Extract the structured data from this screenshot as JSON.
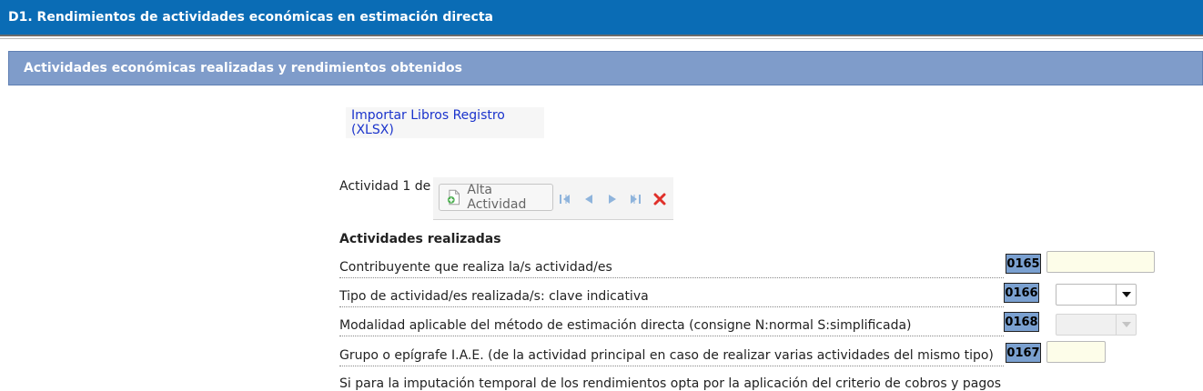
{
  "header": {
    "title": "D1.  Rendimientos de actividades económicas en estimación directa"
  },
  "section": {
    "title": "Actividades económicas realizadas y rendimientos obtenidos"
  },
  "actions": {
    "import_label": "Importar Libros Registro (XLSX)"
  },
  "activity_nav": {
    "counter": "Actividad 1 de 1",
    "add_label": "Alta Actividad",
    "icons": [
      "add-document-icon",
      "first-icon",
      "previous-icon",
      "next-icon",
      "last-icon",
      "delete-icon"
    ]
  },
  "form": {
    "subtitle": "Actividades realizadas",
    "rows": [
      {
        "label": "Contribuyente que realiza la/s actividad/es",
        "code": "0165",
        "value": ""
      },
      {
        "label": "Tipo de actividad/es realizada/s: clave indicativa",
        "code": "0166",
        "value": ""
      },
      {
        "label": "Modalidad aplicable del método de estimación directa (consigne N:normal S:simplificada)",
        "code": "0168",
        "value": ""
      },
      {
        "label": "Grupo o epígrafe I.A.E. (de la actividad principal en caso de realizar varias actividades del mismo tipo)",
        "code": "0167",
        "value": ""
      }
    ],
    "truncated_text": "Si para la imputación temporal de los rendimientos opta por la aplicación del criterio de cobros y pagos"
  },
  "colors": {
    "header_bg": "#0a6cb5",
    "section_bg": "#7f9cca",
    "code_bg": "#7aa0d0",
    "link": "#1a33cc",
    "input_bg": "#fdfde9"
  }
}
